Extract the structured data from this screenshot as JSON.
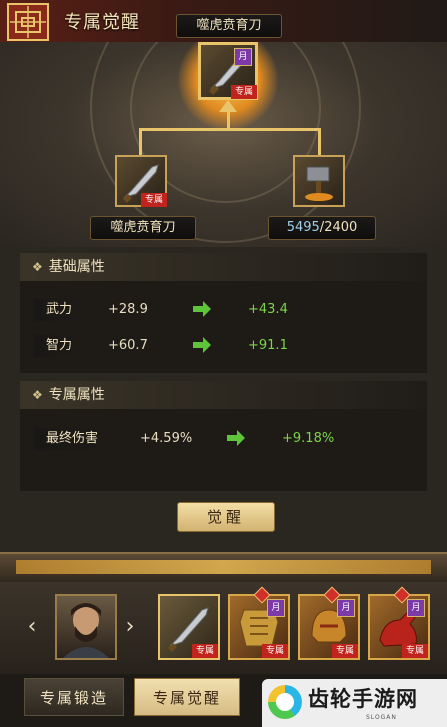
{
  "header": {
    "title": "专属觉醒"
  },
  "target_item": {
    "name": "噬虎贲育刀",
    "tag": "专属",
    "badge": "月"
  },
  "materials": {
    "left": {
      "name": "噬虎贲育刀",
      "tag": "专属"
    },
    "right": {
      "current": "5495",
      "separator": "/",
      "required": "2400"
    }
  },
  "base_attributes": {
    "title": "基础属性",
    "rows": [
      {
        "label": "武力",
        "old": "+28.9",
        "new": "+43.4"
      },
      {
        "label": "智力",
        "old": "+60.7",
        "new": "+91.1"
      }
    ]
  },
  "exclusive_attributes": {
    "title": "专属属性",
    "rows": [
      {
        "label": "最终伤害",
        "old": "+4.59%",
        "new": "+9.18%"
      }
    ]
  },
  "awaken_button": {
    "label": "觉醒"
  },
  "inventory": [
    {
      "tag": "专属",
      "badge": ""
    },
    {
      "tag": "专属",
      "badge": "月"
    },
    {
      "tag": "专属",
      "badge": "月"
    },
    {
      "tag": "专属",
      "badge": "月"
    }
  ],
  "tabs": [
    {
      "label": "专属锻造",
      "active": false
    },
    {
      "label": "专属觉醒",
      "active": true
    }
  ],
  "watermark": {
    "text": "齿轮手游网",
    "sub": "SLOGAN"
  },
  "colors": {
    "gold": "#e8c46a",
    "increase_green": "#7cd44a",
    "tag_red": "#c0241c",
    "moon_purple": "#7b3aa8"
  }
}
